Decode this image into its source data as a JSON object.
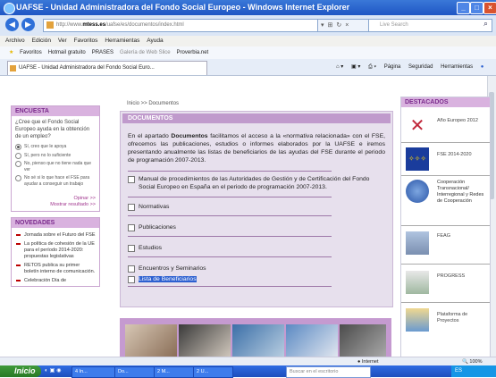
{
  "window": {
    "title": "UAFSE - Unidad Administradora del Fondo Social Europeo - Windows Internet Explorer"
  },
  "address_bar": {
    "url_prefix": "http://www.",
    "url_domain": "mtess.es",
    "url_rest": "/uafse/es/documentos/index.html",
    "search_placeholder": "Live Search"
  },
  "menu": [
    "Archivo",
    "Edición",
    "Ver",
    "Favoritos",
    "Herramientas",
    "Ayuda"
  ],
  "favorites_bar": [
    "Favoritos",
    "Hotmail gratuito",
    "PRASES",
    "Galería de Web Slice",
    "Proverbia.net"
  ],
  "tab": {
    "label": "UAFSE - Unidad Administradora del Fondo Social Euro..."
  },
  "command_bar": [
    "Página",
    "Seguridad",
    "Herramientas"
  ],
  "breadcrumb": "Inicio >> Documentos",
  "encuesta": {
    "heading": "ENCUESTA",
    "question": "¿Cree que el Fondo Social Europeo ayuda en la obtención de un empleo?",
    "options": [
      "Sí, creo que le apoya",
      "Sí, pero no lo suficiente",
      "No, pienso que no tiene nada que ver",
      "No sé si lo que hace el FSE para ayudar a conseguir un trabajo"
    ],
    "opinar": "Opinar >>",
    "mostrar": "Mostrar resultado >>"
  },
  "novedades": {
    "heading": "NOVEDADES",
    "items": [
      "Jornada sobre el Futuro del FSE",
      "La política de cohesión de la UE para el período 2014-2020: propuestas legislativas",
      "RETOS publica su primer boletín interno de comunicación.",
      "Celebración Día de"
    ]
  },
  "documentos": {
    "heading": "DOCUMENTOS",
    "intro_pre": "En el apartado ",
    "intro_bold": "Documentos",
    "intro_post": " facilitamos el acceso a la «normativa relacionada» con el FSE, ofrecemos las publicaciones, estudios o informes elaborados por la UAFSE e iremos presentando anualmente las listas de beneficiarios de las ayudas del FSE durante el periodo de programación 2007-2013.",
    "manual": "Manual de procedimientos de las Autoridades de Gestión y de Certificación del Fondo Social Europeo en España en el periodo de programación 2007-2013.",
    "items": [
      "Normativas",
      "Publicaciones",
      "Estudios",
      "Encuentros y Seminarios",
      "Lista de Beneficiarios"
    ]
  },
  "destacados": {
    "heading": "DESTACADOS",
    "items": [
      "Año Europeo 2012",
      "FSE 2014-2020",
      "Cooperación Transnacional/ Interregional y Redes de Cooperación",
      "FEAG",
      "PROGRESS",
      "Plataforma de Proyectos"
    ]
  },
  "status": {
    "zone": "Internet",
    "zoom": "100%"
  },
  "taskbar": {
    "start": "Inicio",
    "items": [
      "4 In...",
      "Do...",
      "2 M...",
      "2 U...",
      "Buscar en el escritorio"
    ],
    "clock": "ES"
  }
}
